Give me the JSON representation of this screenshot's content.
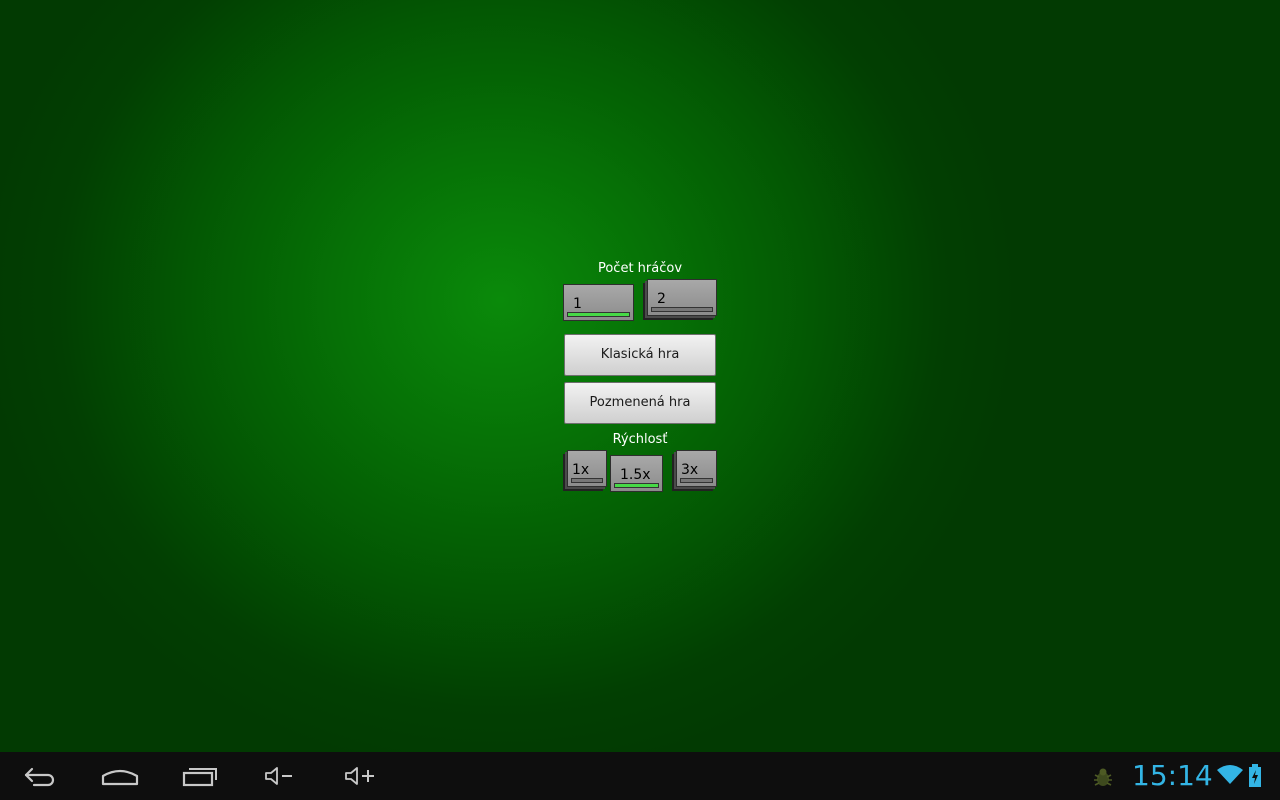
{
  "game": {
    "players_label": "Počet hráčov",
    "players_options": [
      {
        "label": "1",
        "selected": true
      },
      {
        "label": "2",
        "selected": false
      }
    ],
    "classic_button_label": "Klasická hra",
    "modified_button_label": "Pozmenená hra",
    "speed_label": "Rýchlosť",
    "speed_options": [
      {
        "label": "1x",
        "selected": false
      },
      {
        "label": "1.5x",
        "selected": true
      },
      {
        "label": "3x",
        "selected": false
      }
    ]
  },
  "status_bar": {
    "time": "15:14",
    "notification_icon": "bug-icon",
    "wifi_icon": "wifi-icon",
    "battery_icon": "battery-charging-icon"
  },
  "nav_bar": {
    "buttons": [
      "back-icon",
      "home-icon",
      "recent-apps-icon",
      "volume-down-icon",
      "volume-up-icon"
    ]
  },
  "colors": {
    "background_center": "#0a8a0a",
    "background_edge": "#023a02",
    "toggle_selected": "#46d946",
    "clock": "#33b5e5"
  }
}
